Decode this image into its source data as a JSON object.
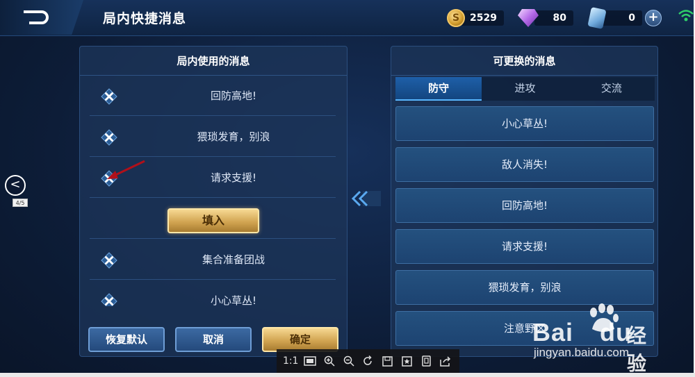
{
  "header": {
    "title": "局内快捷消息",
    "coins": "2529",
    "gems": "80",
    "tickets": "0",
    "coin_symbol": "S",
    "plus_symbol": "+"
  },
  "left_panel": {
    "title": "局内使用的消息",
    "messages": [
      "回防高地!",
      "猥琐发育，别浪",
      "请求支援!",
      "集合准备团战",
      "小心草丛!"
    ],
    "fill_button": "填入",
    "restore_button": "恢复默认",
    "cancel_button": "取消",
    "confirm_button": "确定"
  },
  "right_panel": {
    "title": "可更换的消息",
    "tabs": [
      "防守",
      "进攻",
      "交流"
    ],
    "active_tab": "防守",
    "options": [
      "小心草丛!",
      "敌人消失!",
      "回防高地!",
      "请求支援!",
      "猥琐发育，别浪",
      "注意野区"
    ]
  },
  "viewer": {
    "counter": "4/5",
    "prev_symbol": "<",
    "tools": [
      "1:1",
      "fit-screen-icon",
      "zoom-in-icon",
      "zoom-out-icon",
      "rotate-icon",
      "save-icon",
      "bookmark-icon",
      "copy-icon",
      "share-icon"
    ]
  },
  "watermark": {
    "brand": "Bai",
    "brand_suffix": "du",
    "cn": "经验",
    "url": "jingyan.baidu.com"
  },
  "colors": {
    "gold_button": "#d2a552",
    "blue_button": "#244a7c",
    "active_tab": "#1e5fa8",
    "pointer_arrow": "#b0101a"
  }
}
